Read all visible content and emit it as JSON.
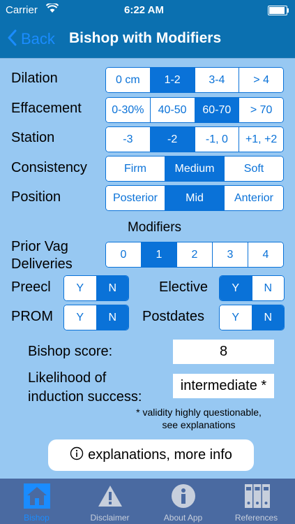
{
  "status_bar": {
    "carrier": "Carrier",
    "time": "6:22 AM"
  },
  "nav": {
    "back_label": "Back",
    "title": "Bishop with Modifiers"
  },
  "rows": {
    "dilation": {
      "label": "Dilation",
      "options": [
        "0 cm",
        "1-2",
        "3-4",
        "> 4"
      ],
      "selected": "1-2"
    },
    "effacement": {
      "label": "Effacement",
      "options": [
        "0-30%",
        "40-50",
        "60-70",
        "> 70"
      ],
      "selected": "60-70"
    },
    "station": {
      "label": "Station",
      "options": [
        "-3",
        "-2",
        "-1, 0",
        "+1, +2"
      ],
      "selected": "-2"
    },
    "consistency": {
      "label": "Consistency",
      "options": [
        "Firm",
        "Medium",
        "Soft"
      ],
      "selected": "Medium"
    },
    "position": {
      "label": "Position",
      "options": [
        "Posterior",
        "Mid",
        "Anterior"
      ],
      "selected": "Mid"
    }
  },
  "modifiers": {
    "heading": "Modifiers",
    "prior_vag": {
      "label_line1": "Prior Vag",
      "label_line2": "Deliveries",
      "options": [
        "0",
        "1",
        "2",
        "3",
        "4"
      ],
      "selected": "1"
    },
    "preecl": {
      "label": "Preecl",
      "options": [
        "Y",
        "N"
      ],
      "selected": "N"
    },
    "elective": {
      "label": "Elective",
      "options": [
        "Y",
        "N"
      ],
      "selected": "Y"
    },
    "prom": {
      "label": "PROM",
      "options": [
        "Y",
        "N"
      ],
      "selected": "N"
    },
    "postdates": {
      "label": "Postdates",
      "options": [
        "Y",
        "N"
      ],
      "selected": "N"
    }
  },
  "results": {
    "score_label": "Bishop score:",
    "score_value": "8",
    "likelihood_line1": "Likelihood of",
    "likelihood_line2": "induction success:",
    "likelihood_value": "intermediate *",
    "note_line1": "* validity highly questionable,",
    "note_line2": "see explanations"
  },
  "info_button": {
    "icon": "info-icon",
    "label": "explanations, more info"
  },
  "tabs": [
    {
      "label": "Bishop",
      "icon": "house-icon",
      "active": true
    },
    {
      "label": "Disclaimer",
      "icon": "warning-icon",
      "active": false
    },
    {
      "label": "About App",
      "icon": "info-icon",
      "active": false
    },
    {
      "label": "References",
      "icon": "binders-icon",
      "active": false
    }
  ],
  "colors": {
    "accent": "#0a72d8",
    "nav_bg": "#0b70b0",
    "panel_bg": "#97c8f2",
    "tabbar_bg": "#4a6aa1"
  }
}
